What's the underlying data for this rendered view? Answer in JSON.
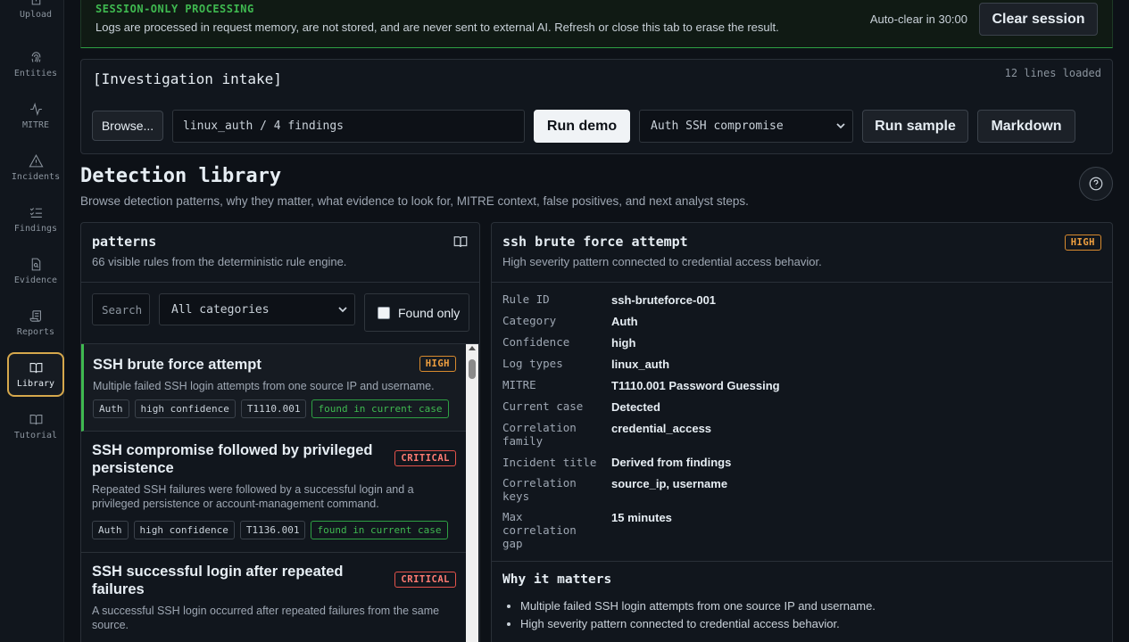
{
  "sidebar": {
    "items": [
      {
        "label": "Upload",
        "icon": "upload-icon"
      },
      {
        "label": "Entities",
        "icon": "fingerprint-icon"
      },
      {
        "label": "MITRE",
        "icon": "activity-icon"
      },
      {
        "label": "Incidents",
        "icon": "alert-triangle-icon"
      },
      {
        "label": "Findings",
        "icon": "list-checks-icon"
      },
      {
        "label": "Evidence",
        "icon": "file-search-icon"
      },
      {
        "label": "Reports",
        "icon": "scroll-icon"
      },
      {
        "label": "Library",
        "icon": "book-open-icon",
        "active": true
      },
      {
        "label": "Tutorial",
        "icon": "book-icon"
      }
    ]
  },
  "banner": {
    "title": "SESSION-ONLY PROCESSING",
    "text": "Logs are processed in request memory, are not stored, and are never sent to external AI. Refresh or close this tab to erase the result.",
    "autoclear": "Auto-clear in 30:00",
    "clear_label": "Clear session"
  },
  "intake": {
    "title": "[Investigation intake]",
    "lines_loaded": "12 lines loaded",
    "browse_label": "Browse...",
    "path_value": "linux_auth / 4 findings",
    "run_demo_label": "Run demo",
    "sample_selected": "Auth SSH compromise",
    "run_sample_label": "Run sample",
    "markdown_label": "Markdown"
  },
  "page": {
    "title": "Detection library",
    "subtitle": "Browse detection patterns, why they matter, what evidence to look for, MITRE context, false positives, and next analyst steps."
  },
  "patterns": {
    "title": "patterns",
    "subtitle": "66 visible rules from the deterministic rule engine.",
    "search_placeholder": "Search",
    "category_selected": "All categories",
    "found_only_label": "Found only",
    "rules": [
      {
        "name": "SSH brute force attempt",
        "severity": "HIGH",
        "description": "Multiple failed SSH login attempts from one source IP and username.",
        "tags": [
          "Auth",
          "high confidence",
          "T1110.001",
          "found in current case"
        ]
      },
      {
        "name": "SSH compromise followed by privileged persistence",
        "severity": "CRITICAL",
        "description": "Repeated SSH failures were followed by a successful login and a privileged persistence or account-management command.",
        "tags": [
          "Auth",
          "high confidence",
          "T1136.001",
          "found in current case"
        ]
      },
      {
        "name": "SSH successful login after repeated failures",
        "severity": "CRITICAL",
        "description": "A successful SSH login occurred after repeated failures from the same source.",
        "tags": []
      }
    ]
  },
  "detail": {
    "title": "ssh brute force attempt",
    "severity": "HIGH",
    "subtitle": "High severity pattern connected to credential access behavior.",
    "fields": [
      {
        "label": "Rule ID",
        "value": "ssh-bruteforce-001"
      },
      {
        "label": "Category",
        "value": "Auth"
      },
      {
        "label": "Confidence",
        "value": "high"
      },
      {
        "label": "Log types",
        "value": "linux_auth"
      },
      {
        "label": "MITRE",
        "value": "T1110.001 Password Guessing"
      },
      {
        "label": "Current case",
        "value": "Detected"
      },
      {
        "label": "Correlation family",
        "value": "credential_access"
      },
      {
        "label": "Incident title",
        "value": "Derived from findings"
      },
      {
        "label": "Correlation keys",
        "value": "source_ip, username"
      },
      {
        "label": "Max correlation gap",
        "value": "15 minutes"
      }
    ],
    "why_title": "Why it matters",
    "why_items": [
      "Multiple failed SSH login attempts from one source IP and username.",
      "High severity pattern connected to credential access behavior."
    ]
  },
  "colors": {
    "accent_green": "#3fb950",
    "severity_high": "#f0a040",
    "severity_critical": "#ff7b72",
    "active_nav_border": "#d6a84c"
  }
}
